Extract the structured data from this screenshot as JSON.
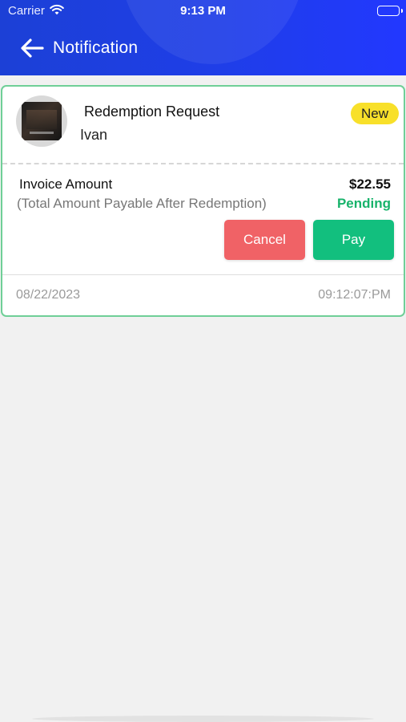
{
  "status_bar": {
    "carrier": "Carrier",
    "time": "9:13 PM",
    "wifi_icon": "wifi-icon",
    "battery_icon": "battery-icon"
  },
  "header": {
    "title": "Notification",
    "back_icon": "arrow-left-icon",
    "gradient_start": "#1c40d6",
    "gradient_end": "#2238ff"
  },
  "notification": {
    "title": "Redemption Request",
    "user": "Ivan",
    "badge": "New",
    "badge_color": "#f8e02a",
    "invoice_label": "Invoice Amount",
    "invoice_sublabel": "(Total Amount Payable After Redemption)",
    "amount": "$22.55",
    "status": "Pending",
    "status_color": "#18b36b",
    "cancel_label": "Cancel",
    "cancel_color": "#f06266",
    "pay_label": "Pay",
    "pay_color": "#12bf7e",
    "date": "08/22/2023",
    "time": "09:12:07:PM",
    "border_color": "#6fcf97"
  }
}
